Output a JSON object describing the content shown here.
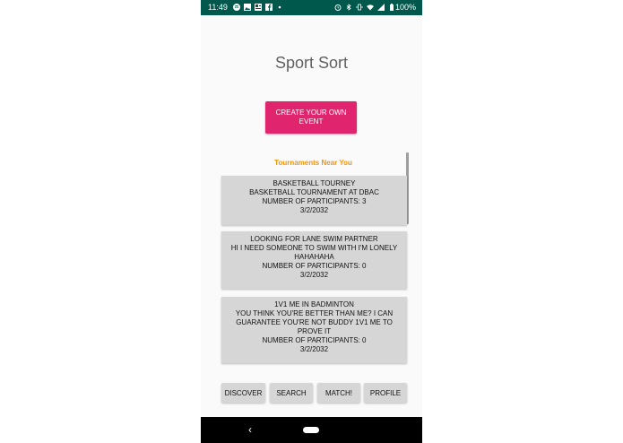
{
  "status_bar": {
    "time": "11:49",
    "battery": "100%",
    "notification_icons": [
      "spotify-icon",
      "image-icon",
      "news-icon",
      "facebook-icon",
      "dot-icon"
    ],
    "system_icons": [
      "alarm-icon",
      "bluetooth-icon",
      "vibrate-icon",
      "wifi-icon",
      "signal-icon",
      "battery-icon"
    ]
  },
  "app": {
    "title": "Sport Sort",
    "create_button_label": "CREATE YOUR OWN EVENT",
    "section_title": "Tournaments Near You"
  },
  "events": [
    {
      "title": "BASKETBALL TOURNEY",
      "description": "BASKETBALL TOURNAMENT AT DBAC",
      "participants": "NUMBER OF PARTICIPANTS: 3",
      "date": "3/2/2032"
    },
    {
      "title": "LOOKING FOR LANE SWIM PARTNER",
      "description": "HI I NEED SOMEONE TO SWIM WITH I'M LONELY HAHAHAHA",
      "participants": "NUMBER OF PARTICIPANTS: 0",
      "date": "3/2/2032"
    },
    {
      "title": "1V1 ME IN BADMINTON",
      "description": "YOU THINK YOU'RE BETTER THAN ME? I CAN GUARANTEE YOU'RE NOT BUDDY 1V1 ME TO PROVE IT",
      "participants": "NUMBER OF PARTICIPANTS: 0",
      "date": "3/2/2032"
    }
  ],
  "bottom_nav": {
    "discover": "DISCOVER",
    "search": "SEARCH",
    "match": "MATCH!",
    "profile": "PROFILE"
  },
  "system_nav": {
    "back_glyph": "‹"
  },
  "colors": {
    "status_bar": "#00574b",
    "accent": "#e0256e",
    "section_title": "#f0950d",
    "card": "#d6d6d6"
  }
}
